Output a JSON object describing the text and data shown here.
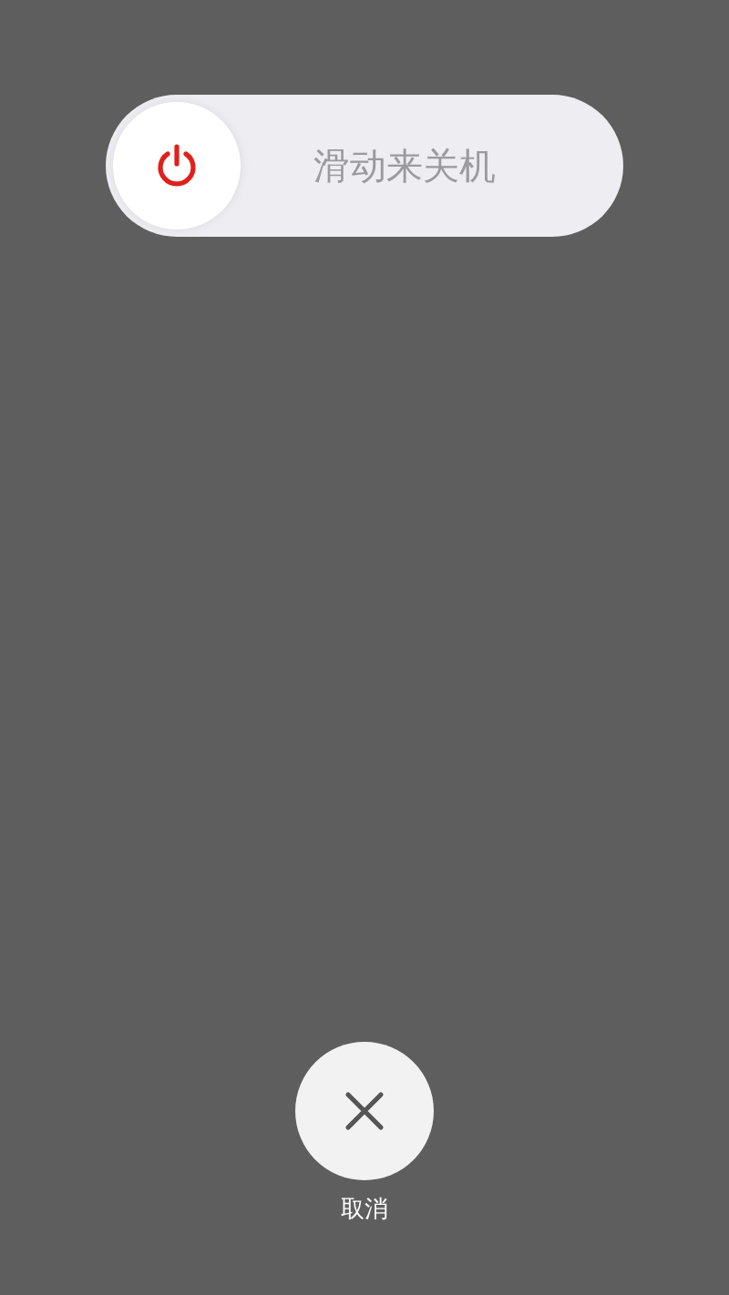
{
  "slider": {
    "label": "滑动来关机",
    "level": 0
  },
  "cancel": {
    "label": "取消"
  }
}
